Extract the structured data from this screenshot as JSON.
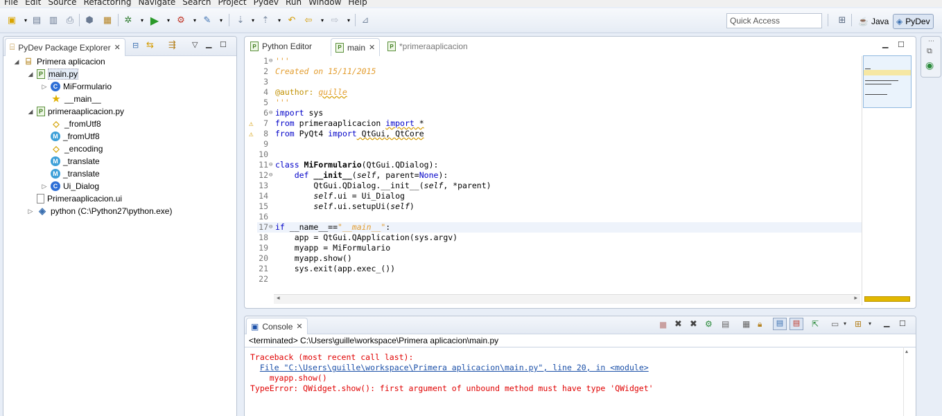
{
  "menu": [
    "File",
    "Edit",
    "Source",
    "Refactoring",
    "Navigate",
    "Search",
    "Project",
    "Pydev",
    "Run",
    "Window",
    "Help"
  ],
  "toolbar": {
    "quick_access_placeholder": "Quick Access",
    "perspectives": [
      {
        "label": "Java",
        "active": false
      },
      {
        "label": "PyDev",
        "active": true
      }
    ]
  },
  "explorer": {
    "tab_label": "PyDev Package Explorer",
    "tree": [
      {
        "label": "Primera aplicacion",
        "icon": "project-icon",
        "level": 0,
        "twisty": "expanded"
      },
      {
        "label": "main.py",
        "icon": "python-module-icon",
        "level": 1,
        "twisty": "expanded",
        "selected": true
      },
      {
        "label": "MiFormulario",
        "icon": "class-icon",
        "level": 2,
        "twisty": "collapsed"
      },
      {
        "label": "__main__",
        "icon": "main-star-icon",
        "level": 2,
        "twisty": "none"
      },
      {
        "label": "primeraaplicacion.py",
        "icon": "python-module-icon",
        "level": 1,
        "twisty": "expanded"
      },
      {
        "label": "_fromUtf8",
        "icon": "attribute-icon",
        "level": 2,
        "twisty": "none"
      },
      {
        "label": "_fromUtf8",
        "icon": "function-icon",
        "level": 2,
        "twisty": "none"
      },
      {
        "label": "_encoding",
        "icon": "attribute-icon",
        "level": 2,
        "twisty": "none"
      },
      {
        "label": "_translate",
        "icon": "function-icon",
        "level": 2,
        "twisty": "none"
      },
      {
        "label": "_translate",
        "icon": "function-icon",
        "level": 2,
        "twisty": "none"
      },
      {
        "label": "Ui_Dialog",
        "icon": "class-icon",
        "level": 2,
        "twisty": "collapsed"
      },
      {
        "label": "Primeraaplicacion.ui",
        "icon": "file-icon",
        "level": 1,
        "twisty": "none"
      },
      {
        "label": "python  (C:\\Python27\\python.exe)",
        "icon": "python-interpreter-icon",
        "level": 0,
        "twisty": "collapsed"
      }
    ]
  },
  "editor": {
    "tabs": [
      {
        "label": "Python Editor",
        "active": false,
        "closable": false
      },
      {
        "label": "main",
        "active": true,
        "closable": true
      },
      {
        "label": "*primeraaplicacion",
        "active": false,
        "closable": false
      }
    ],
    "line_numbers": [
      "1",
      "2",
      "3",
      "4",
      "5",
      "6",
      "7",
      "8",
      "9",
      "10",
      "11",
      "12",
      "13",
      "14",
      "15",
      "16",
      "17",
      "18",
      "19",
      "20",
      "21",
      "22"
    ],
    "code": {
      "l1": "'''",
      "l2": "Created on 15/11/2015",
      "l4a": "@author: ",
      "l4b": "guille",
      "l5": "'''",
      "l6a": "import",
      "l6b": " sys",
      "l7a": "from",
      "l7b": " primeraaplicacion ",
      "l7c": "import",
      "l7d": " *",
      "l8a": "from",
      "l8b": " PyQt4 ",
      "l8c": "import",
      "l8d": " QtGui, QtCore",
      "l11a": "class ",
      "l11b": "MiFormulario",
      "l11c": "(QtGui.QDialog):",
      "l12a": "    def ",
      "l12b": "__init__",
      "l12c": "(",
      "l12d": "self",
      "l12e": ", parent=",
      "l12f": "None",
      "l12g": "):",
      "l13a": "        QtGui.QDialog.__init__(",
      "l13b": "self",
      "l13c": ", *parent)",
      "l14a": "        ",
      "l14b": "self",
      "l14c": ".ui = Ui_Dialog",
      "l15a": "        ",
      "l15b": "self",
      "l15c": ".ui.setupUi(",
      "l15d": "self",
      "l15e": ")",
      "l17a": "if",
      "l17b": " __name__==",
      "l17c": "\"__main__\"",
      "l17d": ":",
      "l18": "    app = QtGui.QApplication(sys.argv)",
      "l19": "    myapp = MiFormulario",
      "l20": "    myapp.show()",
      "l21": "    sys.exit(app.exec_())"
    }
  },
  "console": {
    "tab_label": "Console",
    "status": "<terminated> C:\\Users\\guille\\workspace\\Primera aplicacion\\main.py",
    "lines": {
      "traceback": "Traceback (most recent call last):",
      "file_prefix": "  ",
      "file_link": "File \"C:\\Users\\guille\\workspace\\Primera aplicacion\\main.py\", line 20, in <module>",
      "code": "    myapp.show()",
      "error": "TypeError: QWidget.show(): first argument of unbound method must have type 'QWidget'"
    }
  },
  "colors": {
    "keyword": "#0000c8",
    "string": "#d07a00",
    "error_text": "#e00000",
    "link": "#1a4fa8",
    "background": "#e8eef7"
  }
}
